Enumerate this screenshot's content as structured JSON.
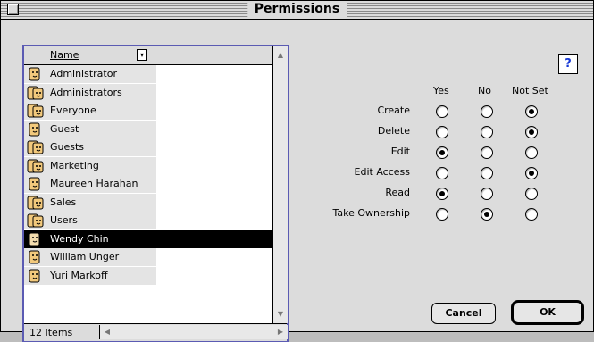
{
  "window": {
    "title": "Permissions"
  },
  "list": {
    "column_header": "Name",
    "items": [
      {
        "name": "Administrator",
        "type": "user",
        "selected": false
      },
      {
        "name": "Administrators",
        "type": "group",
        "selected": false
      },
      {
        "name": "Everyone",
        "type": "group",
        "selected": false
      },
      {
        "name": "Guest",
        "type": "user",
        "selected": false
      },
      {
        "name": "Guests",
        "type": "group",
        "selected": false
      },
      {
        "name": "Marketing",
        "type": "group",
        "selected": false
      },
      {
        "name": "Maureen Harahan",
        "type": "user",
        "selected": false
      },
      {
        "name": "Sales",
        "type": "group",
        "selected": false
      },
      {
        "name": "Users",
        "type": "group",
        "selected": false
      },
      {
        "name": "Wendy Chin",
        "type": "user",
        "selected": true
      },
      {
        "name": "William Unger",
        "type": "user",
        "selected": false
      },
      {
        "name": "Yuri Markoff",
        "type": "user",
        "selected": false
      }
    ],
    "count_label": "12 Items"
  },
  "permissions": {
    "columns": [
      "Yes",
      "No",
      "Not Set"
    ],
    "rows": [
      {
        "label": "Create",
        "value": "Not Set"
      },
      {
        "label": "Delete",
        "value": "Not Set"
      },
      {
        "label": "Edit",
        "value": "Yes"
      },
      {
        "label": "Edit Access",
        "value": "Not Set"
      },
      {
        "label": "Read",
        "value": "Yes"
      },
      {
        "label": "Take Ownership",
        "value": "No"
      }
    ]
  },
  "buttons": {
    "cancel": "Cancel",
    "ok": "OK"
  },
  "icons": {
    "help": "help-icon",
    "user": "user-icon",
    "group": "group-icon",
    "close": "close-box-icon"
  },
  "colors": {
    "list_border": "#5b5bb3",
    "selection": "#000000",
    "help_accent": "#1638d6"
  }
}
